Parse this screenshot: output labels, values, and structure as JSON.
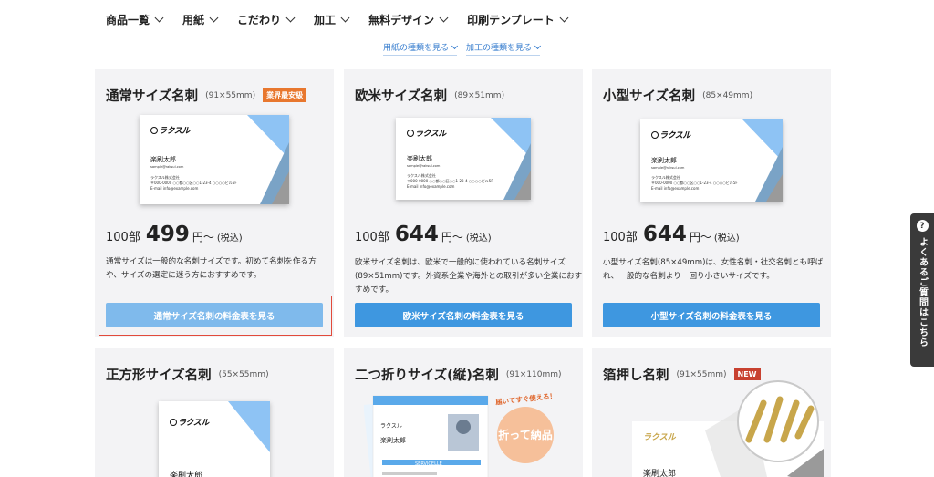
{
  "nav": {
    "items": [
      {
        "label": "商品一覧"
      },
      {
        "label": "用紙"
      },
      {
        "label": "こだわり"
      },
      {
        "label": "加工"
      },
      {
        "label": "無料デザイン"
      },
      {
        "label": "印刷テンプレート"
      }
    ],
    "sublinks": [
      {
        "label": "用紙の種類を見る"
      },
      {
        "label": "加工の種類を見る"
      }
    ]
  },
  "cards": [
    {
      "title": "通常サイズ名刺",
      "size": "(91×55mm)",
      "badge": "業界最安級",
      "price_prefix": "100部",
      "price": "499",
      "price_suffix": "円〜",
      "tax": "(税込)",
      "desc": "通常サイズは一般的な名刺サイズです。初めて名刺を作る方や、サイズの選定に迷う方におすすめです。",
      "button": "通常サイズ名刺の料金表を見る"
    },
    {
      "title": "欧米サイズ名刺",
      "size": "(89×51mm)",
      "price_prefix": "100部",
      "price": "644",
      "price_suffix": "円〜",
      "tax": "(税込)",
      "desc": "欧米サイズ名刺は、欧米で一般的に使われている名刺サイズ(89×51mm)です。外資系企業や海外との取引が多い企業におすすめです。",
      "button": "欧米サイズ名刺の料金表を見る"
    },
    {
      "title": "小型サイズ名刺",
      "size": "(85×49mm)",
      "price_prefix": "100部",
      "price": "644",
      "price_suffix": "円〜",
      "tax": "(税込)",
      "desc": "小型サイズ名刺(85×49mm)は、女性名刺・社交名刺とも呼ばれ、一般的な名刺より一回り小さいサイズです。",
      "button": "小型サイズ名刺の料金表を見る"
    },
    {
      "title": "正方形サイズ名刺",
      "size": "(55×55mm)"
    },
    {
      "title": "二つ折りサイズ(縦)名刺",
      "size": "(91×110mm)",
      "tagline": "届いてすぐ使える！",
      "circle": "折って納品"
    },
    {
      "title": "箔押し名刺",
      "size": "(91×55mm)",
      "badge": "NEW"
    }
  ],
  "sample_card": {
    "logo": "ラクスル",
    "name": "楽刷太郎",
    "email": "sample@raksul.com",
    "company": "ラクスル株式会社",
    "address": "〒000-0000 ○○都○○区○○1-23-4 ○○○○ビル5F",
    "email_line": "E-mail info@example.com"
  },
  "fold_card": {
    "logo": "ラクスル",
    "name": "楽刷太郎",
    "service": "SERVICELLE"
  },
  "help": {
    "icon": "?",
    "label": "よくあるご質問はこちら"
  },
  "colors": {
    "accent": "#3e97e0",
    "accent_soft": "#7fbaec",
    "highlight": "#e24a3b",
    "badge_orange": "#e8772e",
    "badge_red": "#c84130",
    "card_bg": "#f3f3f5"
  }
}
